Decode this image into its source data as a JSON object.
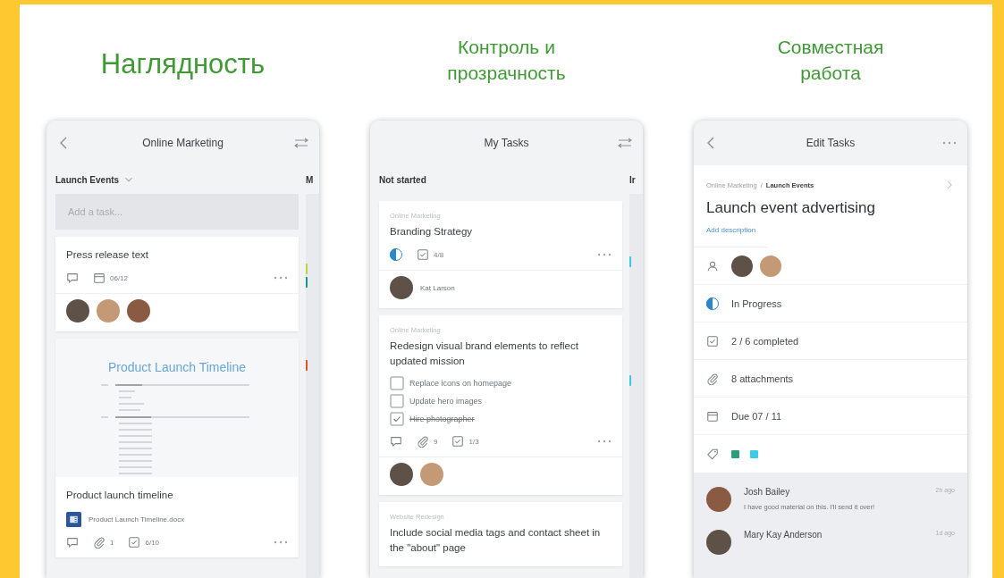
{
  "headings": [
    "Наглядность",
    "Контроль и\nпрозрачность",
    "Совместная\nработа"
  ],
  "board": {
    "title": "Online Marketing",
    "bucket": "Launch Events",
    "next_bucket": "M",
    "add_task": {
      "placeholder": "Add a task..."
    },
    "label_marks": [
      {
        "color": "#b6d83a"
      },
      {
        "color": "#17998a"
      },
      {
        "color": "#e0532b"
      }
    ],
    "cards": [
      {
        "kind": "basic",
        "title": "Press release text",
        "comments": true,
        "due": "06/12",
        "assignees": [
          {
            "kind": "photo"
          },
          {
            "kind": "photo"
          },
          {
            "kind": "photo"
          }
        ]
      },
      {
        "kind": "preview",
        "preview_title": "Product Launch Timeline",
        "title": "Product launch timeline",
        "attachment": "Product Launch Timeline.docx",
        "comments": true,
        "attachments": "1",
        "checklist": "6/10"
      }
    ]
  },
  "my_tasks": {
    "title": "My Tasks",
    "column": "Not started",
    "next_column": "Ir",
    "label_marks": [
      {
        "color": "#3fc6e0"
      },
      {
        "color": "#3fc6e0"
      }
    ],
    "cards": [
      {
        "plan": "Online Marketing",
        "title": "Branding Strategy",
        "level": 0.5,
        "checklist": "4/8",
        "assignees": [
          {
            "kind": "photo",
            "name": "Kat Larson"
          }
        ]
      },
      {
        "plan": "Online Marketing",
        "title": "Redesign visual brand elements to reflect updated mission",
        "items": [
          {
            "text": "Replace icons on homepage",
            "checked": false
          },
          {
            "text": "Update hero images",
            "checked": false
          },
          {
            "text": "Hire photographer",
            "checked": true
          }
        ],
        "comments": true,
        "attachments": "9",
        "checklist": "1/3",
        "assignees": [
          {
            "kind": "photo"
          },
          {
            "kind": "photo"
          }
        ]
      },
      {
        "plan": "Website Redesign",
        "title": "Include social media tags and contact sheet in the \"about\" page"
      }
    ]
  },
  "edit_task": {
    "title": "Edit Tasks",
    "plan": "Online Marketing",
    "separator": "/",
    "bucket": "Launch Events",
    "task_title": "Launch event advertising",
    "add_description": "Add description",
    "rows": [
      {
        "kind": "assignees",
        "assignees": [
          {
            "kind": "photo"
          },
          {
            "kind": "photo"
          }
        ]
      },
      {
        "kind": "status",
        "level": 0.5,
        "text": "In Progress"
      },
      {
        "kind": "checklist",
        "text": "2 / 6 completed"
      },
      {
        "kind": "attachments",
        "text": "8 attachments"
      },
      {
        "kind": "due",
        "text": "Due 07 / 11"
      },
      {
        "kind": "labels",
        "labels": [
          {
            "color": "#2a9d7f"
          },
          {
            "color": "#3fcbe8"
          }
        ]
      }
    ],
    "comments": [
      {
        "author": "Josh Bailey",
        "time": "2h ago",
        "text": "I have good material on this. I'll send it over!"
      },
      {
        "author": "Mary Kay Anderson",
        "time": "1d ago"
      }
    ]
  }
}
